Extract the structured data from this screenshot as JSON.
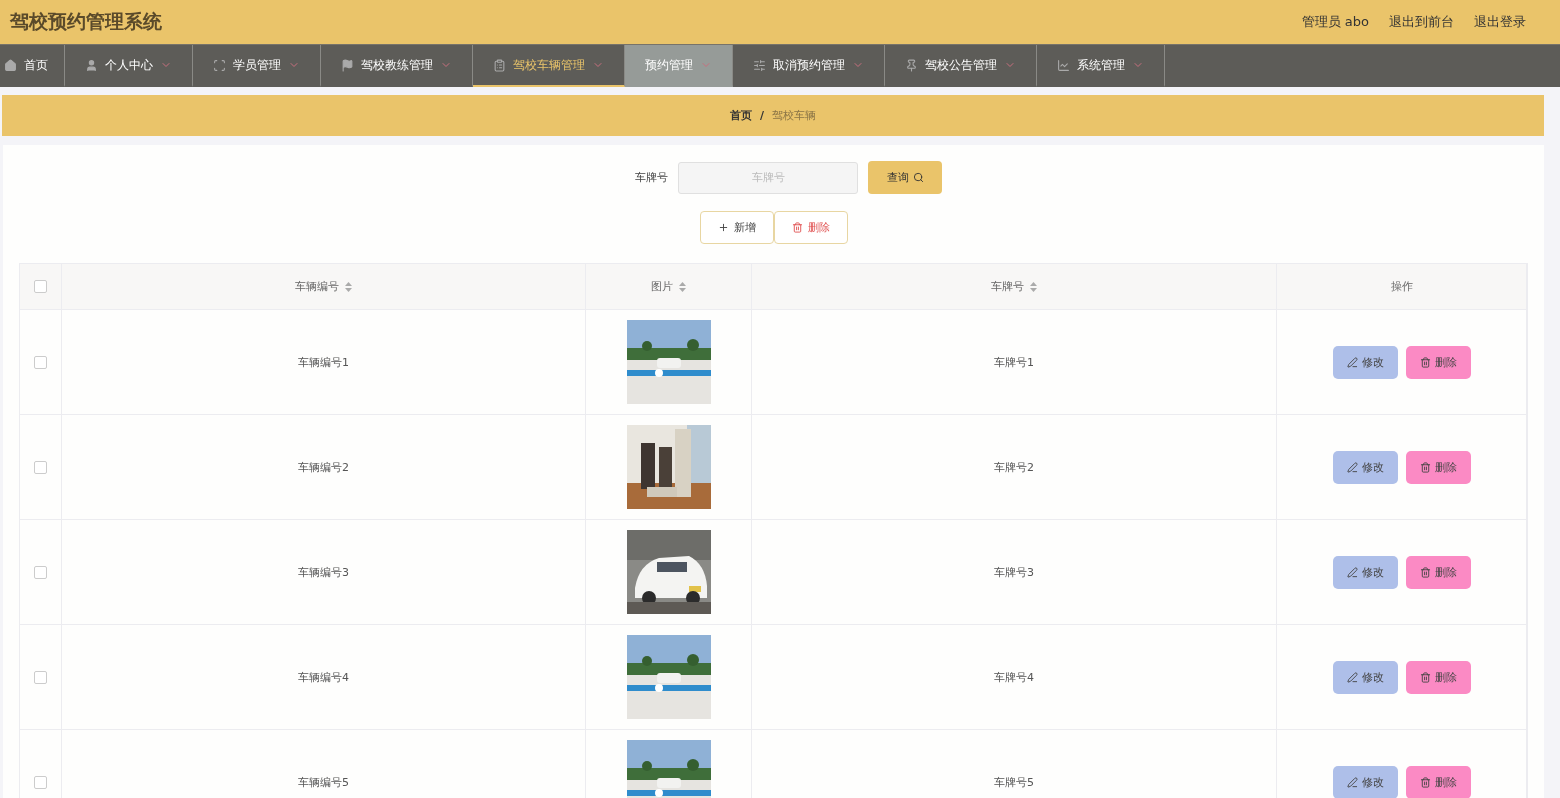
{
  "header": {
    "title": "驾校预约管理系统",
    "user": "管理员 abo",
    "links": [
      "退出到前台",
      "退出登录"
    ]
  },
  "nav": [
    {
      "label": "首页",
      "dropdown": false,
      "selected": false,
      "hovered": false
    },
    {
      "label": "个人中心",
      "dropdown": true,
      "selected": false,
      "hovered": false
    },
    {
      "label": "学员管理",
      "dropdown": true,
      "selected": false,
      "hovered": false
    },
    {
      "label": "驾校教练管理",
      "dropdown": true,
      "selected": false,
      "hovered": false
    },
    {
      "label": "驾校车辆管理",
      "dropdown": true,
      "selected": true,
      "hovered": false
    },
    {
      "label": "预约管理",
      "dropdown": true,
      "selected": false,
      "hovered": true
    },
    {
      "label": "取消预约管理",
      "dropdown": true,
      "selected": false,
      "hovered": false
    },
    {
      "label": "驾校公告管理",
      "dropdown": true,
      "selected": false,
      "hovered": false
    },
    {
      "label": "系统管理",
      "dropdown": true,
      "selected": false,
      "hovered": false
    }
  ],
  "breadcrumb": {
    "items": [
      "首页",
      "驾校车辆"
    ],
    "separator": "/"
  },
  "search": {
    "label": "车牌号",
    "placeholder": "车牌号",
    "button": "查询"
  },
  "actions": {
    "add": "新增",
    "delete": "删除"
  },
  "table": {
    "select_all": false,
    "columns": [
      {
        "label": "车辆编号",
        "sortable": true
      },
      {
        "label": "图片",
        "sortable": true
      },
      {
        "label": "车牌号",
        "sortable": true
      },
      {
        "label": "操作",
        "sortable": false
      }
    ],
    "rows": [
      {
        "checked": false,
        "number": "车辆编号1",
        "plate": "车牌号1",
        "edit": "修改",
        "delete": "删除"
      },
      {
        "checked": false,
        "number": "车辆编号2",
        "plate": "车牌号2",
        "edit": "修改",
        "delete": "删除"
      },
      {
        "checked": false,
        "number": "车辆编号3",
        "plate": "车牌号3",
        "edit": "修改",
        "delete": "删除"
      },
      {
        "checked": false,
        "number": "车辆编号4",
        "plate": "车牌号4",
        "edit": "修改",
        "delete": "删除"
      },
      {
        "checked": false,
        "number": "车辆编号5",
        "plate": "车牌号5",
        "edit": "修改",
        "delete": "删除"
      }
    ]
  }
}
